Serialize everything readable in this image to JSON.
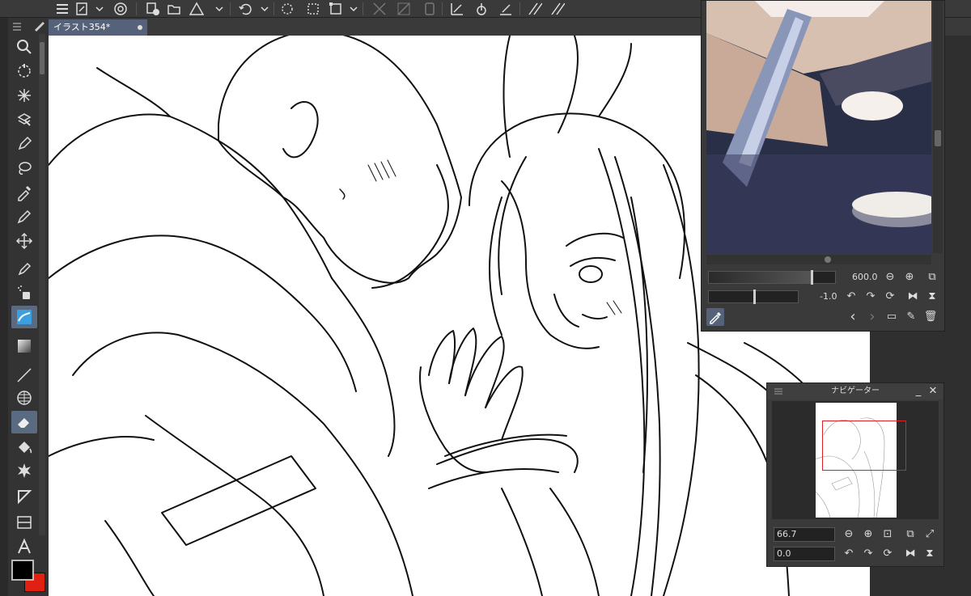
{
  "document": {
    "tab_title": "イラスト354*"
  },
  "subview": {
    "zoom_value": "600.0",
    "rotation_value": "-1.0"
  },
  "navigator": {
    "title": "ナビゲーター",
    "zoom_value": "66.7",
    "rotation_value": "0.0"
  },
  "colors": {
    "main_color": "#000000",
    "sub_color": "#e02010",
    "accent": "#56627a",
    "nav_frame": "#e02020"
  },
  "tools": [
    "zoom-icon",
    "move-icon",
    "auto-select-icon",
    "object-select-icon",
    "pen-icon",
    "lasso-icon",
    "eyedropper-icon",
    "pencil-icon",
    "move-layer-icon",
    "brush-icon",
    "airbrush-icon",
    "decoration-icon",
    "gradient-icon",
    "line-icon",
    "ruler-icon",
    "eraser-icon",
    "fill-icon",
    "blend-icon",
    "figure-icon",
    "frame-icon",
    "text-icon"
  ]
}
